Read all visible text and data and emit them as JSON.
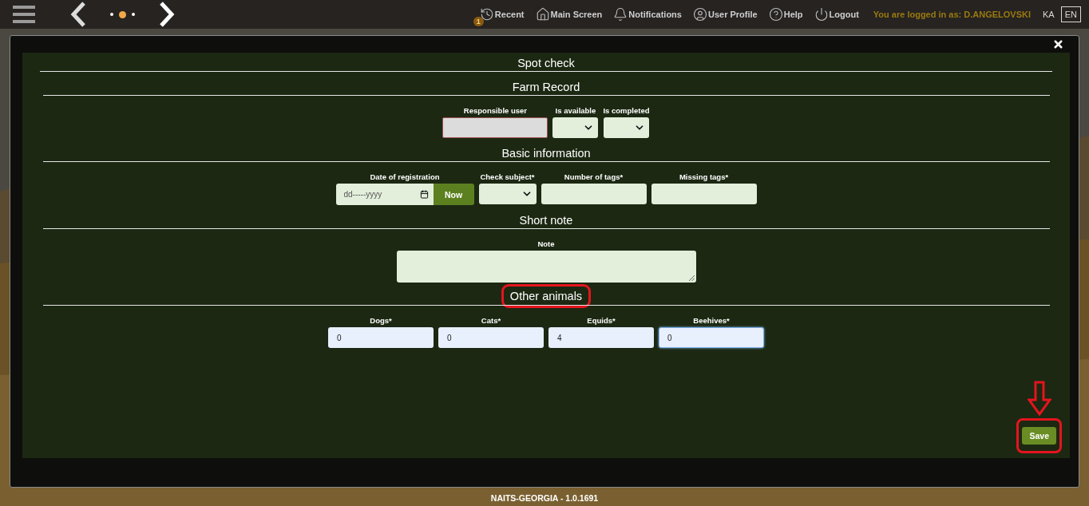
{
  "topbar": {
    "nav_dots": [
      {
        "selected": false
      },
      {
        "selected": true
      },
      {
        "selected": false
      }
    ],
    "links": [
      {
        "kind": "recent",
        "label": "Recent",
        "badge": "1"
      },
      {
        "kind": "home",
        "label": "Main Screen"
      },
      {
        "kind": "bell",
        "label": "Notifications"
      },
      {
        "kind": "user",
        "label": "User Profile"
      },
      {
        "kind": "help",
        "label": "Help"
      },
      {
        "kind": "power",
        "label": "Logout"
      }
    ],
    "login_text": "You are logged in as: D.ANGELOVSKI",
    "languages": [
      {
        "label": "KA",
        "selected": false
      },
      {
        "label": "EN",
        "selected": true
      }
    ]
  },
  "modal": {
    "title": "Spot check",
    "sections": [
      {
        "title": "Farm Record",
        "highlighted": false,
        "fields": [
          {
            "kind": "readonly",
            "label": "Responsible user"
          },
          {
            "kind": "select",
            "label": "Is available"
          },
          {
            "kind": "select",
            "label": "Is completed"
          }
        ]
      },
      {
        "title": "Basic information",
        "highlighted": false,
        "fields": [
          {
            "kind": "date",
            "label": "Date of registration",
            "placeholder": "dd-----yyyy",
            "button": "Now"
          },
          {
            "kind": "select",
            "label": "Check subject*"
          },
          {
            "kind": "input",
            "label": "Number of tags*"
          },
          {
            "kind": "input",
            "label": "Missing tags*"
          }
        ]
      },
      {
        "title": "Short note",
        "highlighted": false,
        "fields": [
          {
            "kind": "textarea",
            "label": "Note"
          }
        ]
      },
      {
        "title": "Other animals",
        "highlighted": true,
        "fields": [
          {
            "kind": "number",
            "label": "Dogs*",
            "value": "0",
            "focused": false
          },
          {
            "kind": "number",
            "label": "Cats*",
            "value": "0",
            "focused": false
          },
          {
            "kind": "number",
            "label": "Equids*",
            "value": "4",
            "focused": false
          },
          {
            "kind": "number",
            "label": "Beehives*",
            "value": "0",
            "focused": true
          }
        ]
      }
    ],
    "save": {
      "label": "Save",
      "highlighted": true
    }
  },
  "footer": "NAITS-GEORGIA - 1.0.1691"
}
